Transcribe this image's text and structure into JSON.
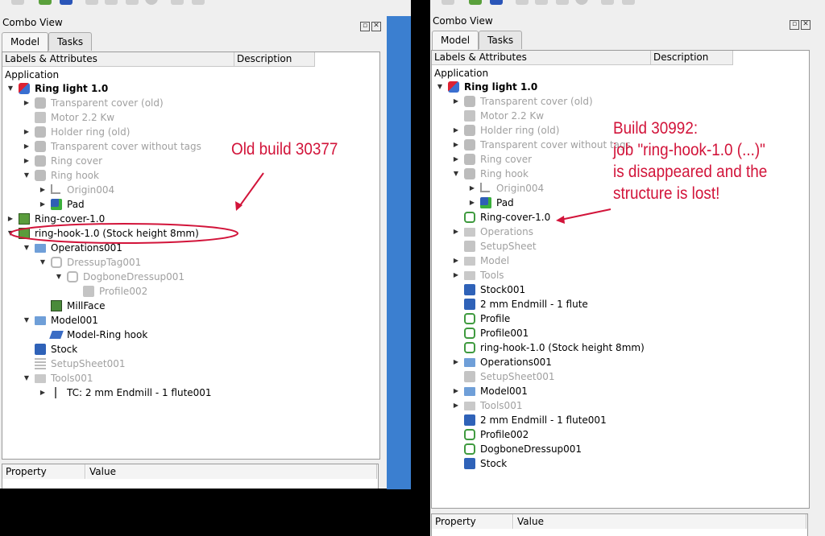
{
  "left": {
    "title": "Combo View",
    "tabs": [
      {
        "label": "Model"
      },
      {
        "label": "Tasks"
      }
    ],
    "columns": {
      "labels": "Labels & Attributes",
      "description": "Description"
    },
    "root": "Application",
    "rows": [
      {
        "label": "Ring light 1.0",
        "icon": "part",
        "arrow": "down",
        "level": 0,
        "state": "bold"
      },
      {
        "label": "Transparent cover (old)",
        "icon": "gray-part",
        "arrow": "right",
        "level": 1,
        "state": "gray"
      },
      {
        "label": "Motor 2.2 Kw",
        "icon": "gray-cylinder",
        "arrow": "",
        "level": 1,
        "state": "gray"
      },
      {
        "label": "Holder ring (old)",
        "icon": "gray-part",
        "arrow": "right",
        "level": 1,
        "state": "gray"
      },
      {
        "label": "Transparent cover without tags",
        "icon": "gray-part",
        "arrow": "right",
        "level": 1,
        "state": "gray"
      },
      {
        "label": "Ring cover",
        "icon": "gray-part",
        "arrow": "right",
        "level": 1,
        "state": "gray"
      },
      {
        "label": "Ring hook",
        "icon": "gray-part",
        "arrow": "down",
        "level": 1,
        "state": "gray"
      },
      {
        "label": "Origin004",
        "icon": "gray-origin",
        "arrow": "right",
        "level": 2,
        "state": "gray"
      },
      {
        "label": "Pad",
        "icon": "pad",
        "arrow": "right",
        "level": 2,
        "state": "normal"
      },
      {
        "label": "Ring-cover-1.0",
        "icon": "job",
        "arrow": "right",
        "level": 0,
        "state": "normal"
      },
      {
        "label": "ring-hook-1.0 (Stock height 8mm)",
        "icon": "job",
        "arrow": "down",
        "level": 0,
        "state": "normal"
      },
      {
        "label": "Operations001",
        "icon": "folder",
        "arrow": "down",
        "level": 1,
        "state": "normal"
      },
      {
        "label": "DressupTag001",
        "icon": "gray-path",
        "arrow": "down",
        "level": 2,
        "state": "gray"
      },
      {
        "label": "DogboneDressup001",
        "icon": "gray-path",
        "arrow": "down",
        "level": 3,
        "state": "gray"
      },
      {
        "label": "Profile002",
        "icon": "gray-profile",
        "arrow": "",
        "level": 4,
        "state": "gray"
      },
      {
        "label": "MillFace",
        "icon": "millface",
        "arrow": "",
        "level": 2,
        "state": "normal"
      },
      {
        "label": "Model001",
        "icon": "folder",
        "arrow": "down",
        "level": 1,
        "state": "normal"
      },
      {
        "label": "Model-Ring hook",
        "icon": "model",
        "arrow": "",
        "level": 2,
        "state": "normal"
      },
      {
        "label": "Stock",
        "icon": "box",
        "arrow": "",
        "level": 1,
        "state": "normal"
      },
      {
        "label": "SetupSheet001",
        "icon": "gray-sheet",
        "arrow": "",
        "level": 1,
        "state": "gray"
      },
      {
        "label": "Tools001",
        "icon": "gray-folder",
        "arrow": "down",
        "level": 1,
        "state": "gray"
      },
      {
        "label": "TC: 2 mm Endmill - 1 flute001",
        "icon": "tool",
        "arrow": "right",
        "level": 2,
        "state": "normal"
      }
    ],
    "property": {
      "property": "Property",
      "value": "Value"
    }
  },
  "right": {
    "title": "Combo View",
    "tabs": [
      {
        "label": "Model"
      },
      {
        "label": "Tasks"
      }
    ],
    "columns": {
      "labels": "Labels & Attributes",
      "description": "Description"
    },
    "root": "Application",
    "rows": [
      {
        "label": "Ring light 1.0",
        "icon": "part",
        "arrow": "down",
        "level": 0,
        "state": "bold"
      },
      {
        "label": "Transparent cover (old)",
        "icon": "gray-part",
        "arrow": "right",
        "level": 1,
        "state": "gray"
      },
      {
        "label": "Motor 2.2 Kw",
        "icon": "gray-cylinder",
        "arrow": "",
        "level": 1,
        "state": "gray"
      },
      {
        "label": "Holder ring (old)",
        "icon": "gray-part",
        "arrow": "right",
        "level": 1,
        "state": "gray"
      },
      {
        "label": "Transparent cover without tags",
        "icon": "gray-part",
        "arrow": "right",
        "level": 1,
        "state": "gray"
      },
      {
        "label": "Ring cover",
        "icon": "gray-part",
        "arrow": "right",
        "level": 1,
        "state": "gray"
      },
      {
        "label": "Ring hook",
        "icon": "gray-part",
        "arrow": "down",
        "level": 1,
        "state": "gray"
      },
      {
        "label": "Origin004",
        "icon": "gray-origin",
        "arrow": "right",
        "level": 2,
        "state": "gray"
      },
      {
        "label": "Pad",
        "icon": "pad",
        "arrow": "right",
        "level": 2,
        "state": "normal"
      },
      {
        "label": "Ring-cover-1.0",
        "icon": "path",
        "arrow": "",
        "level": 1,
        "state": "normal"
      },
      {
        "label": "Operations",
        "icon": "gray-folder",
        "arrow": "right",
        "level": 1,
        "state": "gray"
      },
      {
        "label": "SetupSheet",
        "icon": "gray-cylinder",
        "arrow": "",
        "level": 1,
        "state": "gray"
      },
      {
        "label": "Model",
        "icon": "gray-folder",
        "arrow": "right",
        "level": 1,
        "state": "gray"
      },
      {
        "label": "Tools",
        "icon": "gray-folder",
        "arrow": "right",
        "level": 1,
        "state": "gray"
      },
      {
        "label": "Stock001",
        "icon": "box",
        "arrow": "",
        "level": 1,
        "state": "normal"
      },
      {
        "label": "2 mm Endmill - 1 flute",
        "icon": "box",
        "arrow": "",
        "level": 1,
        "state": "normal"
      },
      {
        "label": "Profile",
        "icon": "path",
        "arrow": "",
        "level": 1,
        "state": "normal"
      },
      {
        "label": "Profile001",
        "icon": "path",
        "arrow": "",
        "level": 1,
        "state": "normal"
      },
      {
        "label": "ring-hook-1.0 (Stock height 8mm)",
        "icon": "path",
        "arrow": "",
        "level": 1,
        "state": "normal"
      },
      {
        "label": "Operations001",
        "icon": "folder",
        "arrow": "right",
        "level": 1,
        "state": "normal"
      },
      {
        "label": "SetupSheet001",
        "icon": "gray-cylinder",
        "arrow": "",
        "level": 1,
        "state": "gray"
      },
      {
        "label": "Model001",
        "icon": "folder",
        "arrow": "right",
        "level": 1,
        "state": "normal"
      },
      {
        "label": "Tools001",
        "icon": "gray-folder",
        "arrow": "right",
        "level": 1,
        "state": "gray"
      },
      {
        "label": "2 mm Endmill - 1 flute001",
        "icon": "box",
        "arrow": "",
        "level": 1,
        "state": "normal"
      },
      {
        "label": "Profile002",
        "icon": "path",
        "arrow": "",
        "level": 1,
        "state": "normal"
      },
      {
        "label": "DogboneDressup001",
        "icon": "path",
        "arrow": "",
        "level": 1,
        "state": "normal"
      },
      {
        "label": "Stock",
        "icon": "box",
        "arrow": "",
        "level": 1,
        "state": "normal"
      }
    ],
    "property": {
      "property": "Property",
      "value": "Value"
    }
  },
  "annotations": {
    "old_build": "Old build 30377",
    "new_build_lines": [
      "Build 30992:",
      "job \"ring-hook-1.0 (...)\"",
      "is disappeared and the",
      "structure is lost!"
    ]
  },
  "colors": {
    "annotation": "#d2143a",
    "window_blue": "#3b7fd0",
    "disabled_text": "#a0a0a0"
  }
}
